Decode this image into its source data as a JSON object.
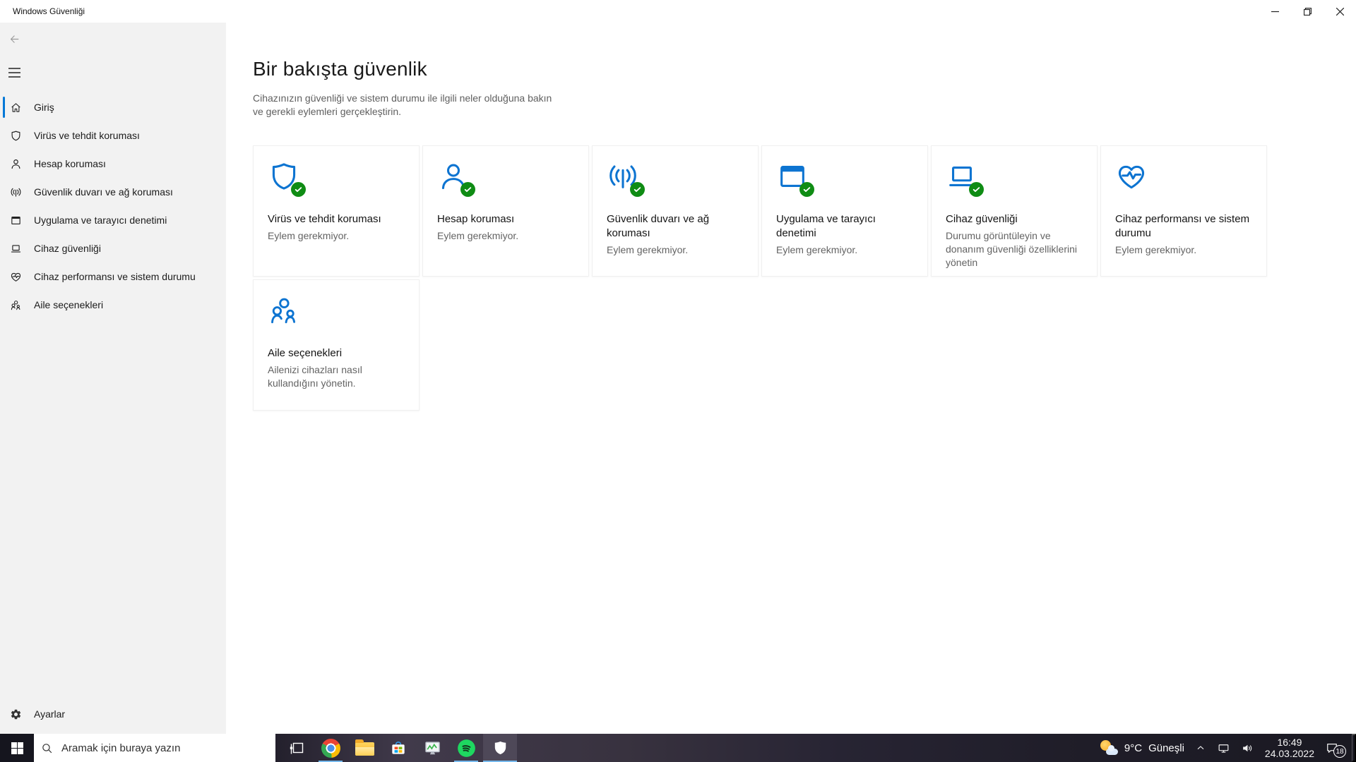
{
  "window": {
    "title": "Windows Güvenliği"
  },
  "sidebar": {
    "items": [
      {
        "icon": "home-icon",
        "label": "Giriş",
        "selected": true
      },
      {
        "icon": "shield-icon",
        "label": "Virüs ve tehdit koruması",
        "selected": false
      },
      {
        "icon": "person-icon",
        "label": "Hesap koruması",
        "selected": false
      },
      {
        "icon": "firewall-icon",
        "label": "Güvenlik duvarı ve ağ koruması",
        "selected": false
      },
      {
        "icon": "app-window-icon",
        "label": "Uygulama ve tarayıcı denetimi",
        "selected": false
      },
      {
        "icon": "laptop-icon",
        "label": "Cihaz güvenliği",
        "selected": false
      },
      {
        "icon": "heart-pulse-icon",
        "label": "Cihaz performansı ve sistem durumu",
        "selected": false
      },
      {
        "icon": "family-icon",
        "label": "Aile seçenekleri",
        "selected": false
      }
    ],
    "settings_label": "Ayarlar"
  },
  "main": {
    "heading": "Bir bakışta güvenlik",
    "subtitle": "Cihazınızın güvenliği ve sistem durumu ile ilgili neler olduğuna bakın ve gerekli eylemleri gerçekleştirin.",
    "cards": [
      {
        "icon": "shield-icon",
        "title": "Virüs ve tehdit koruması",
        "status": "Eylem gerekmiyor.",
        "ok_badge": true
      },
      {
        "icon": "person-icon",
        "title": "Hesap koruması",
        "status": "Eylem gerekmiyor.",
        "ok_badge": true
      },
      {
        "icon": "firewall-icon",
        "title": "Güvenlik duvarı ve ağ koruması",
        "status": "Eylem gerekmiyor.",
        "ok_badge": true
      },
      {
        "icon": "app-window-icon",
        "title": "Uygulama ve tarayıcı denetimi",
        "status": "Eylem gerekmiyor.",
        "ok_badge": true
      },
      {
        "icon": "laptop-icon",
        "title": "Cihaz güvenliği",
        "status": "Durumu görüntüleyin ve donanım güvenliği özelliklerini yönetin",
        "ok_badge": true
      },
      {
        "icon": "heart-pulse-icon",
        "title": "Cihaz performansı ve sistem durumu",
        "status": "Eylem gerekmiyor.",
        "ok_badge": false
      },
      {
        "icon": "family-icon",
        "title": "Aile seçenekleri",
        "status": "Ailenizi cihazları nasıl kullandığını yönetin.",
        "ok_badge": false
      }
    ]
  },
  "taskbar": {
    "search_placeholder": "Aramak için buraya yazın",
    "apps": [
      {
        "name": "task-view",
        "running": false,
        "active": false
      },
      {
        "name": "google-chrome",
        "running": true,
        "active": false
      },
      {
        "name": "file-explorer",
        "running": false,
        "active": false
      },
      {
        "name": "microsoft-store",
        "running": false,
        "active": false
      },
      {
        "name": "task-manager",
        "running": false,
        "active": false
      },
      {
        "name": "spotify",
        "running": true,
        "active": false
      },
      {
        "name": "windows-security",
        "running": true,
        "active": true
      }
    ],
    "tray": {
      "weather_temp": "9°C",
      "weather_condition": "Güneşli",
      "time": "16:49",
      "date": "24.03.2022",
      "notification_count": "18"
    }
  },
  "colors": {
    "accent": "#0078d7",
    "icon_blue": "#0d74d1",
    "ok_green": "#0f8c14",
    "sidebar_bg": "#f2f2f2",
    "taskbar_active_bg": "#4e4858",
    "running_indicator": "#76b9ed"
  }
}
